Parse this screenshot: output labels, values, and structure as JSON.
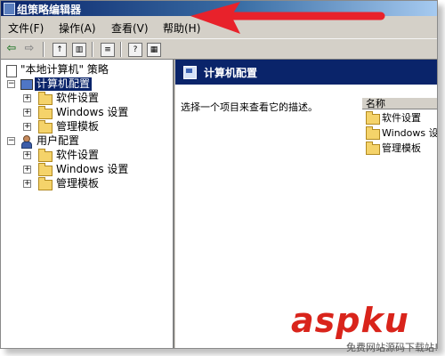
{
  "window": {
    "title": "组策略编辑器"
  },
  "menu": [
    {
      "label": "文件(F)"
    },
    {
      "label": "操作(A)"
    },
    {
      "label": "查看(V)"
    },
    {
      "label": "帮助(H)"
    }
  ],
  "toolbar": {
    "icons": [
      "back-arrow-icon",
      "forward-arrow-icon",
      "up-folder-icon",
      "show-hide-tree-icon",
      "export-list-icon",
      "help-icon",
      "properties-icon"
    ]
  },
  "tree": {
    "root": "\"本地计算机\" 策略",
    "computer_config": {
      "label": "计算机配置",
      "children": [
        "软件设置",
        "Windows 设置",
        "管理模板"
      ]
    },
    "user_config": {
      "label": "用户配置",
      "children": [
        "软件设置",
        "Windows 设置",
        "管理模板"
      ]
    }
  },
  "details": {
    "header": "计算机配置",
    "description": "选择一个项目来查看它的描述。",
    "column_name": "名称",
    "items": [
      "软件设置",
      "Windows 设",
      "管理模板"
    ]
  },
  "watermark": {
    "brand": "aspku",
    "sub": "免费网站源码下载站!"
  },
  "colors": {
    "selection": "#0a246a",
    "annotation_arrow": "#e8222b",
    "watermark": "#d9241b"
  }
}
